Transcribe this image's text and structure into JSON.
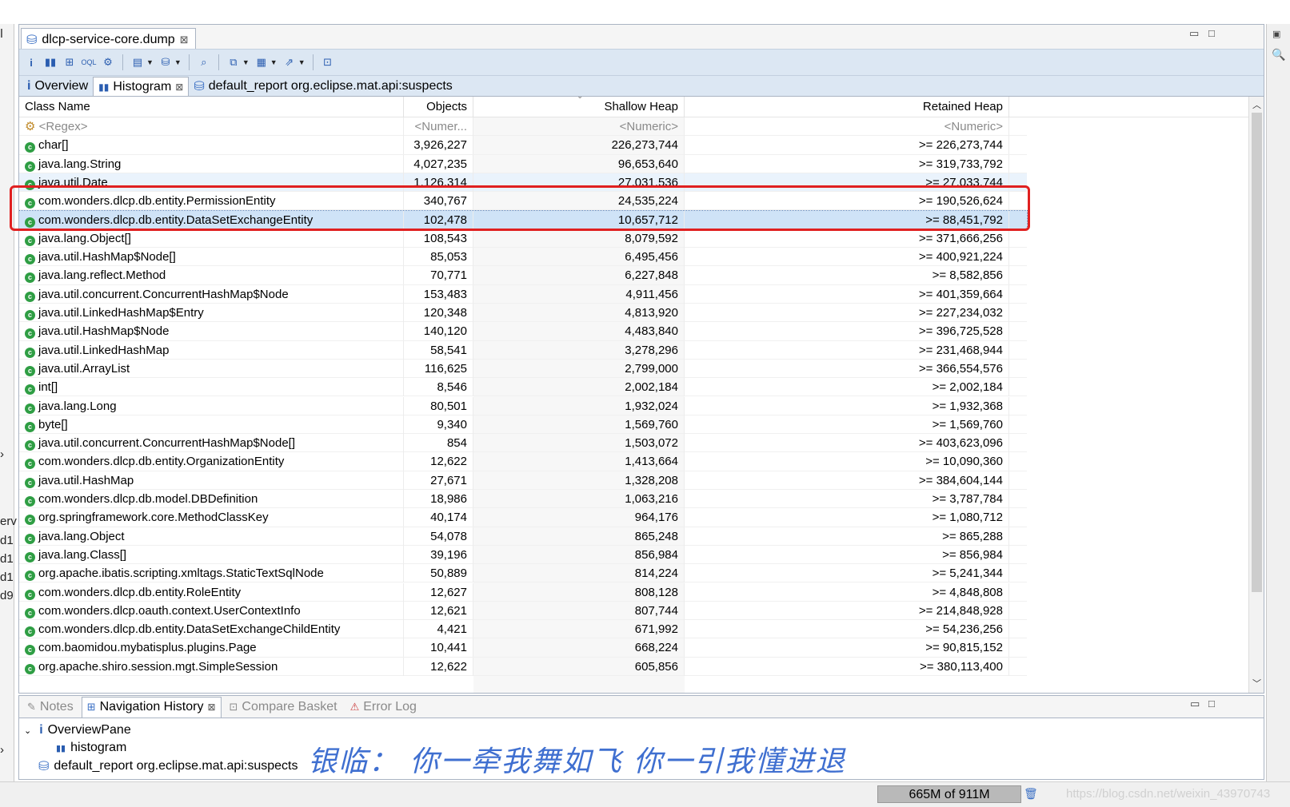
{
  "editor": {
    "tab_title": "dlcp-service-core.dump",
    "close_glyph": "⊠",
    "minimize_glyph": "▭",
    "maximize_glyph": "□"
  },
  "subtabs": [
    {
      "label": "Overview",
      "icon": "info-icon"
    },
    {
      "label": "Histogram",
      "icon": "histogram-icon"
    },
    {
      "label": "default_report  org.eclipse.mat.api:suspects",
      "icon": "report-icon"
    }
  ],
  "table": {
    "headers": [
      "Class Name",
      "Objects",
      "Shallow Heap",
      "Retained Heap"
    ],
    "filter": [
      "<Regex>",
      "<Numer...",
      "<Numeric>",
      "<Numeric>"
    ],
    "rows": [
      [
        "char[]",
        "3,926,227",
        "226,273,744",
        ">= 226,273,744"
      ],
      [
        "java.lang.String",
        "4,027,235",
        "96,653,640",
        ">= 319,733,792"
      ],
      [
        "java.util.Date",
        "1,126,314",
        "27,031,536",
        ">= 27,033,744"
      ],
      [
        "com.wonders.dlcp.db.entity.PermissionEntity",
        "340,767",
        "24,535,224",
        ">= 190,526,624"
      ],
      [
        "com.wonders.dlcp.db.entity.DataSetExchangeEntity",
        "102,478",
        "10,657,712",
        ">= 88,451,792"
      ],
      [
        "java.lang.Object[]",
        "108,543",
        "8,079,592",
        ">= 371,666,256"
      ],
      [
        "java.util.HashMap$Node[]",
        "85,053",
        "6,495,456",
        ">= 400,921,224"
      ],
      [
        "java.lang.reflect.Method",
        "70,771",
        "6,227,848",
        ">= 8,582,856"
      ],
      [
        "java.util.concurrent.ConcurrentHashMap$Node",
        "153,483",
        "4,911,456",
        ">= 401,359,664"
      ],
      [
        "java.util.LinkedHashMap$Entry",
        "120,348",
        "4,813,920",
        ">= 227,234,032"
      ],
      [
        "java.util.HashMap$Node",
        "140,120",
        "4,483,840",
        ">= 396,725,528"
      ],
      [
        "java.util.LinkedHashMap",
        "58,541",
        "3,278,296",
        ">= 231,468,944"
      ],
      [
        "java.util.ArrayList",
        "116,625",
        "2,799,000",
        ">= 366,554,576"
      ],
      [
        "int[]",
        "8,546",
        "2,002,184",
        ">= 2,002,184"
      ],
      [
        "java.lang.Long",
        "80,501",
        "1,932,024",
        ">= 1,932,368"
      ],
      [
        "byte[]",
        "9,340",
        "1,569,760",
        ">= 1,569,760"
      ],
      [
        "java.util.concurrent.ConcurrentHashMap$Node[]",
        "854",
        "1,503,072",
        ">= 403,623,096"
      ],
      [
        "com.wonders.dlcp.db.entity.OrganizationEntity",
        "12,622",
        "1,413,664",
        ">= 10,090,360"
      ],
      [
        "java.util.HashMap",
        "27,671",
        "1,328,208",
        ">= 384,604,144"
      ],
      [
        "com.wonders.dlcp.db.model.DBDefinition",
        "18,986",
        "1,063,216",
        ">= 3,787,784"
      ],
      [
        "org.springframework.core.MethodClassKey",
        "40,174",
        "964,176",
        ">= 1,080,712"
      ],
      [
        "java.lang.Object",
        "54,078",
        "865,248",
        ">= 865,288"
      ],
      [
        "java.lang.Class[]",
        "39,196",
        "856,984",
        ">= 856,984"
      ],
      [
        "org.apache.ibatis.scripting.xmltags.StaticTextSqlNode",
        "50,889",
        "814,224",
        ">= 5,241,344"
      ],
      [
        "com.wonders.dlcp.db.entity.RoleEntity",
        "12,627",
        "808,128",
        ">= 4,848,808"
      ],
      [
        "com.wonders.dlcp.oauth.context.UserContextInfo",
        "12,621",
        "807,744",
        ">= 214,848,928"
      ],
      [
        "com.wonders.dlcp.db.entity.DataSetExchangeChildEntity",
        "4,421",
        "671,992",
        ">= 54,236,256"
      ],
      [
        "com.baomidou.mybatisplus.plugins.Page",
        "10,441",
        "668,224",
        ">= 90,815,152"
      ],
      [
        "org.apache.shiro.session.mgt.SimpleSession",
        "12,622",
        "605,856",
        ">= 380,113,400"
      ]
    ]
  },
  "bottom": {
    "tabs": [
      {
        "label": "Notes",
        "active": false
      },
      {
        "label": "Navigation History",
        "active": true
      },
      {
        "label": "Compare Basket",
        "active": false
      },
      {
        "label": "Error Log",
        "active": false
      }
    ],
    "tree": {
      "root": "OverviewPane",
      "child1": "histogram",
      "child2": "default_report  org.eclipse.mat.api:suspects"
    }
  },
  "overlay_text": "银临：  你一牵我舞如飞  你一引我懂进退",
  "status": {
    "heap": "665M of 911M",
    "watermark": "https://blog.csdn.net/weixin_43970743"
  },
  "left_fragments": [
    "erv",
    "d1",
    "d1",
    "d1",
    "d9"
  ],
  "colors": {
    "selection": "#cfe3f7",
    "highlight_box": "#e02020",
    "toolbar_bg": "#dce7f3",
    "class_icon": "#2f9e44"
  }
}
